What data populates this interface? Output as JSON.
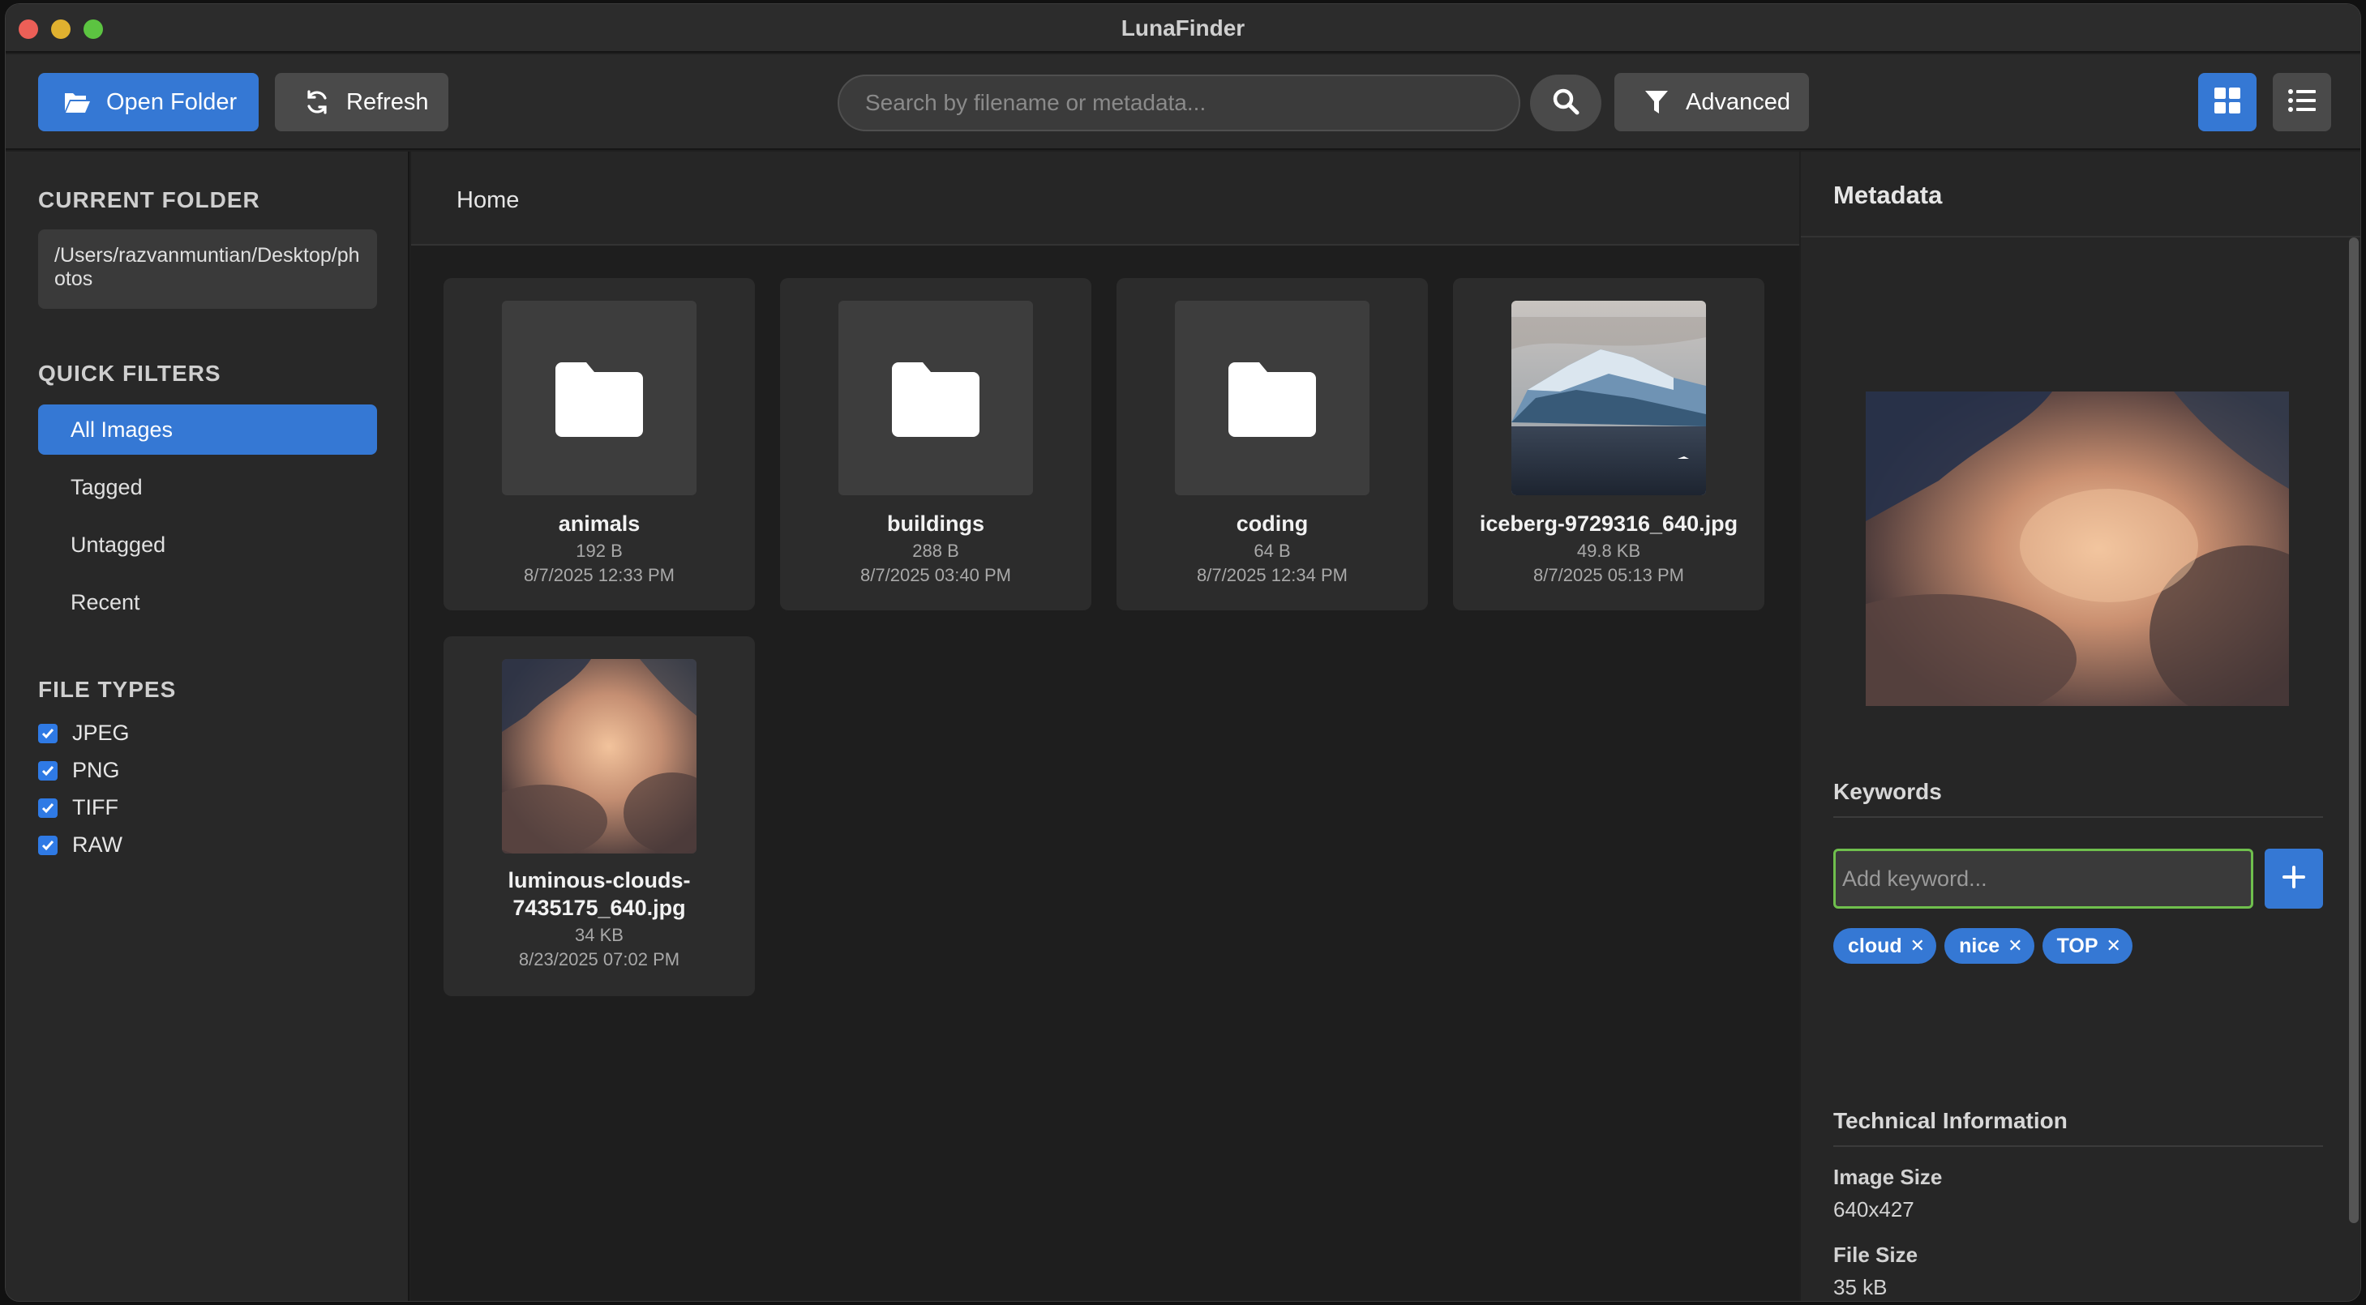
{
  "window": {
    "title": "LunaFinder"
  },
  "toolbar": {
    "open_folder_label": "Open Folder",
    "refresh_label": "Refresh",
    "search_placeholder": "Search by filename or metadata...",
    "advanced_label": "Advanced",
    "active_view": "grid"
  },
  "sidebar": {
    "current_folder_title": "CURRENT FOLDER",
    "current_folder_path": "/Users/razvanmuntian/Desktop/photos",
    "quick_filters_title": "QUICK FILTERS",
    "quick_filters": [
      {
        "label": "All Images",
        "active": true
      },
      {
        "label": "Tagged",
        "active": false
      },
      {
        "label": "Untagged",
        "active": false
      },
      {
        "label": "Recent",
        "active": false
      }
    ],
    "file_types_title": "FILE TYPES",
    "file_types": [
      {
        "label": "JPEG",
        "checked": true
      },
      {
        "label": "PNG",
        "checked": true
      },
      {
        "label": "TIFF",
        "checked": true
      },
      {
        "label": "RAW",
        "checked": true
      }
    ]
  },
  "main": {
    "breadcrumb": "Home",
    "items": [
      {
        "type": "folder",
        "name": "animals",
        "size": "192 B",
        "date": "8/7/2025 12:33 PM"
      },
      {
        "type": "folder",
        "name": "buildings",
        "size": "288 B",
        "date": "8/7/2025 03:40 PM"
      },
      {
        "type": "folder",
        "name": "coding",
        "size": "64 B",
        "date": "8/7/2025 12:34 PM"
      },
      {
        "type": "image",
        "thumb": "iceberg",
        "name": "iceberg-9729316_640.jpg",
        "size": "49.8 KB",
        "date": "8/7/2025 05:13 PM"
      },
      {
        "type": "image",
        "thumb": "clouds",
        "name": "luminous-clouds-7435175_640.jpg",
        "size": "34 KB",
        "date": "8/23/2025 07:02 PM"
      }
    ]
  },
  "metadata": {
    "title": "Metadata",
    "keywords_title": "Keywords",
    "keyword_placeholder": "Add keyword...",
    "keywords": [
      "cloud",
      "nice",
      "TOP"
    ],
    "tech_title": "Technical Information",
    "image_size_label": "Image Size",
    "image_size_value": "640x427",
    "file_size_label": "File Size",
    "file_size_value": "35 kB"
  },
  "colors": {
    "accent": "#3578d4",
    "focus_ring": "#6fbf4d",
    "window_bg": "#1f1f1f"
  }
}
